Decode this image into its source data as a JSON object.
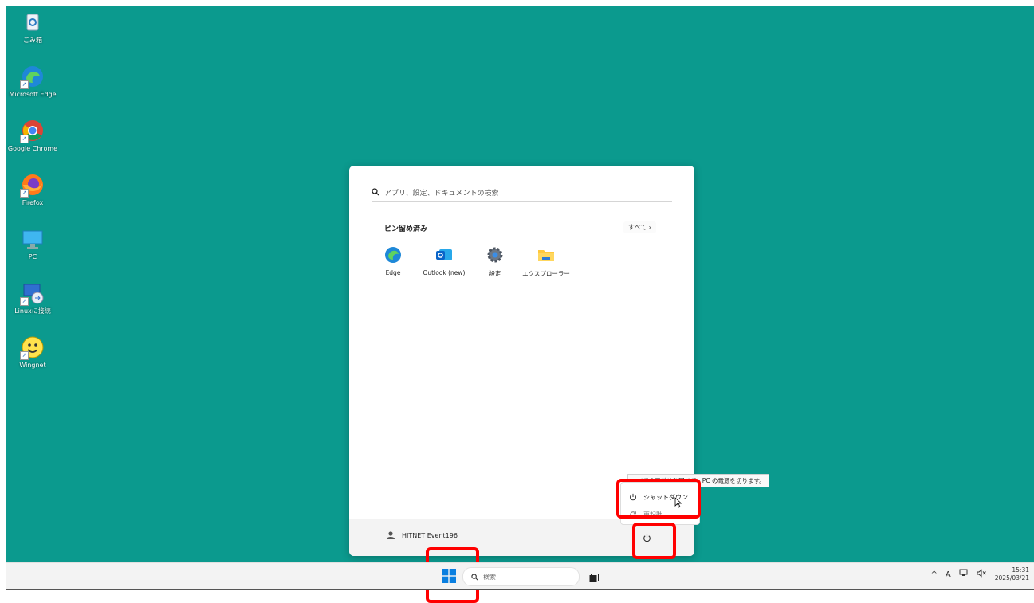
{
  "desktop_icons": [
    {
      "label": "ごみ箱",
      "icon": "recycle-bin-icon"
    },
    {
      "label": "Microsoft Edge",
      "icon": "edge-icon"
    },
    {
      "label": "Google Chrome",
      "icon": "chrome-icon"
    },
    {
      "label": "Firefox",
      "icon": "firefox-icon"
    },
    {
      "label": "PC",
      "icon": "pc-icon"
    },
    {
      "label": "Linuxに接続",
      "icon": "remote-desktop-icon"
    },
    {
      "label": "Wingnet",
      "icon": "smiley-icon"
    }
  ],
  "start_menu": {
    "search_placeholder": "アプリ、設定、ドキュメントの検索",
    "pinned_title": "ピン留め済み",
    "all_label": "すべて  ›",
    "apps": [
      {
        "label": "Edge",
        "icon": "edge-icon"
      },
      {
        "label": "Outlook (new)",
        "icon": "outlook-icon"
      },
      {
        "label": "設定",
        "icon": "settings-icon"
      },
      {
        "label": "エクスプローラー",
        "icon": "folder-icon"
      }
    ],
    "user_name": "HITNET Event196"
  },
  "power_menu": {
    "tooltip": "すべてのアプリを閉じて、PC の電源を切ります。",
    "shutdown_label": "シャットダウン",
    "restart_label": "再起動"
  },
  "taskbar": {
    "search_placeholder": "検索",
    "tray_chevron": "^",
    "ime_label": "A",
    "time": "15:31",
    "date": "2025/03/21"
  },
  "colors": {
    "desktop": "#0b9a8e",
    "highlight": "#ff0000",
    "accent": "#0078d4"
  }
}
